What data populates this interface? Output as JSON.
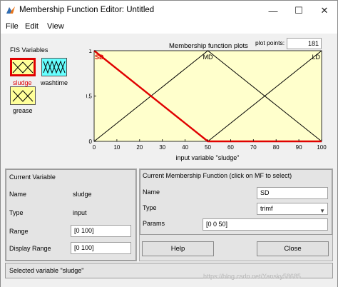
{
  "window": {
    "title": "Membership Function Editor: Untitled",
    "minimize": "—",
    "maximize": "☐",
    "close": "✕"
  },
  "menu": [
    {
      "label": "File"
    },
    {
      "label": "Edit"
    },
    {
      "label": "View"
    }
  ],
  "fis_variables": {
    "title": "FIS Variables",
    "items": [
      {
        "label": "sludge",
        "selected": true,
        "color": "#ffff99"
      },
      {
        "label": "washtime",
        "selected": false,
        "color": "#66ffff"
      },
      {
        "label": "grease",
        "selected": false,
        "color": "#ffff99"
      }
    ]
  },
  "plot": {
    "title": "Membership function plots",
    "plot_points_label": "plot points:",
    "plot_points_value": "181",
    "xlabel": "input variable \"sludge\"",
    "background": "#ffffcc"
  },
  "chart_data": {
    "type": "line",
    "xlim": [
      0,
      100
    ],
    "ylim": [
      0,
      1
    ],
    "x_ticks": [
      "0",
      "10",
      "20",
      "30",
      "40",
      "50",
      "60",
      "70",
      "80",
      "90",
      "100"
    ],
    "y_ticks": [
      "0",
      "0.5",
      "1"
    ],
    "xlabel": "input variable \"sludge\"",
    "series": [
      {
        "name": "SD",
        "x": [
          0,
          0,
          50,
          100
        ],
        "y": [
          1,
          1,
          0,
          0
        ],
        "color": "#e00000",
        "highlighted": true
      },
      {
        "name": "MD",
        "x": [
          0,
          50,
          100
        ],
        "y": [
          0,
          1,
          0
        ],
        "color": "#000000",
        "highlighted": false
      },
      {
        "name": "LD",
        "x": [
          50,
          100,
          100
        ],
        "y": [
          0,
          1,
          1
        ],
        "color": "#000000",
        "highlighted": false
      }
    ]
  },
  "current_variable": {
    "title": "Current Variable",
    "name_label": "Name",
    "name_value": "sludge",
    "type_label": "Type",
    "type_value": "input",
    "range_label": "Range",
    "range_value": "[0 100]",
    "display_range_label": "Display Range",
    "display_range_value": "[0 100]"
  },
  "current_mf": {
    "title": "Current Membership Function (click on MF to select)",
    "name_label": "Name",
    "name_value": "SD",
    "type_label": "Type",
    "type_value": "trimf",
    "params_label": "Params",
    "params_value": "[0 0 50]"
  },
  "buttons": {
    "help": "Help",
    "close": "Close"
  },
  "status": "Selected variable \"sludge\"",
  "watermark": "https://blog.csdn.net/Yansky58685"
}
